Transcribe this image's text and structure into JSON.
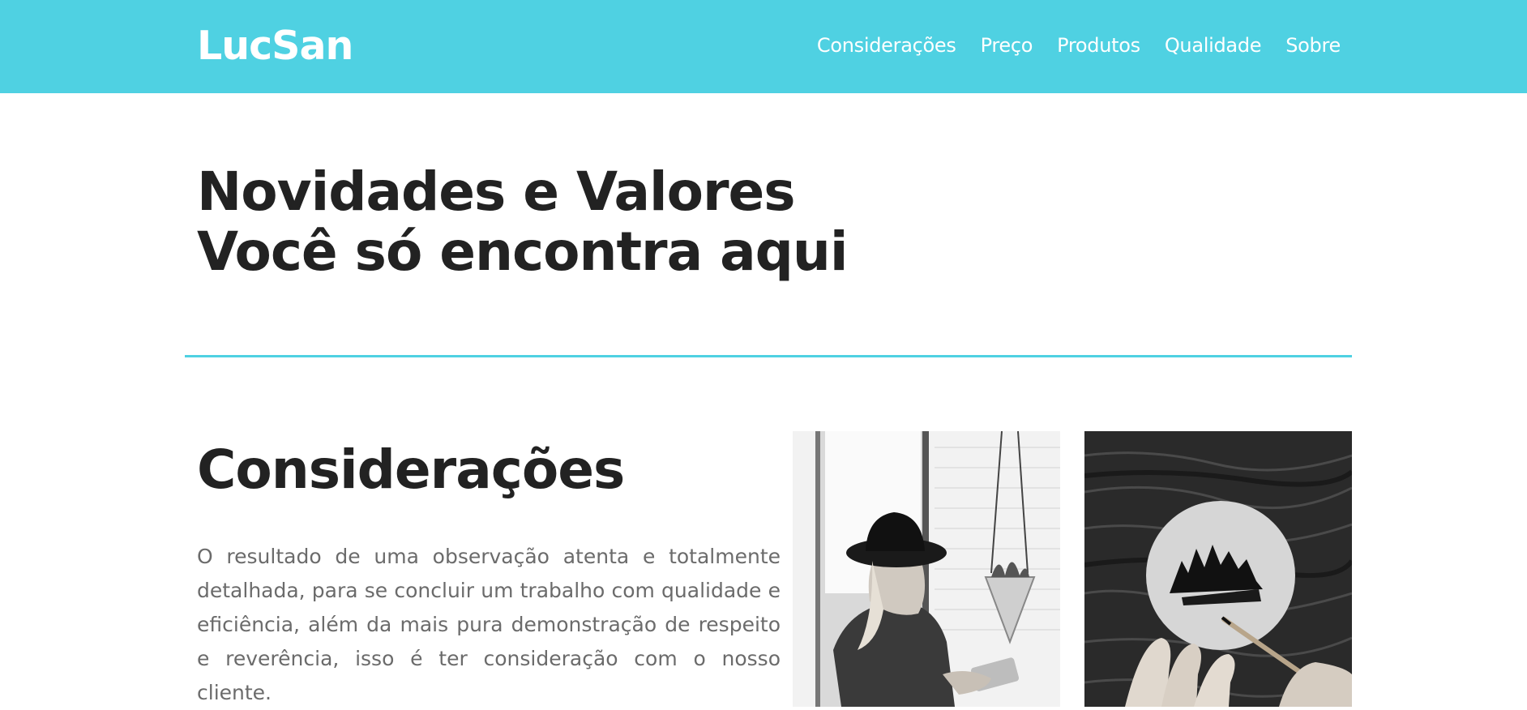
{
  "header": {
    "brand": "LucSan",
    "nav": [
      "Considerações",
      "Preço",
      "Produtos",
      "Qualidade",
      "Sobre"
    ],
    "colors": {
      "accent": "#4fd1e2",
      "text": "#ffffff"
    }
  },
  "hero": {
    "line1": "Novidades e Valores",
    "line2": "Você só encontra aqui"
  },
  "section": {
    "title": "Considerações",
    "paragraph": "O resultado de uma observação atenta e totalmente detalhada, para se concluir um trabalho com qualidade e eficiência, além da mais pura demonstração de respeito e reverência, isso é ter consideração com o nosso cliente."
  },
  "images": [
    {
      "name": "woman-in-hat-photo"
    },
    {
      "name": "hand-painting-tree-photo"
    }
  ]
}
